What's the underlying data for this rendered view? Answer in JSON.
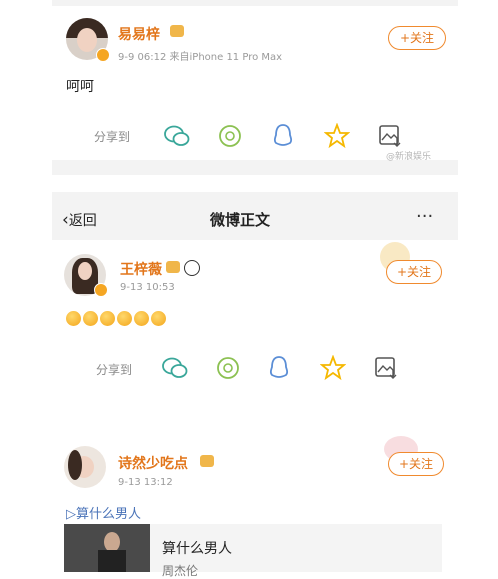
{
  "post1": {
    "username": "易易梓",
    "meta": "9-9 06:12  来自iPhone 11 Pro Max",
    "body": "呵呵",
    "follow": "+关注",
    "share_label": "分享到",
    "watermark": "@新浪娱乐"
  },
  "nav": {
    "back": "返回",
    "title": "微博正文",
    "more": "···"
  },
  "post2": {
    "username": "王梓薇",
    "meta": "9-13 10:53",
    "follow": "+关注",
    "share_label": "分享到"
  },
  "post3": {
    "username": "诗然少吃点",
    "meta": "9-13 13:12",
    "follow": "+关注",
    "link": "▷算什么男人",
    "song_title": "算什么男人",
    "song_artist": "周杰伦"
  },
  "icons": [
    "wechat-icon",
    "moments-icon",
    "qq-icon",
    "qzone-icon",
    "save-image-icon"
  ],
  "colors": {
    "accent": "#e2761b",
    "follow_border": "#f08a2e",
    "icon_teal": "#3aa79a",
    "icon_green": "#8cc152",
    "icon_blue": "#5b8ed6",
    "icon_yellow": "#f5b800"
  }
}
